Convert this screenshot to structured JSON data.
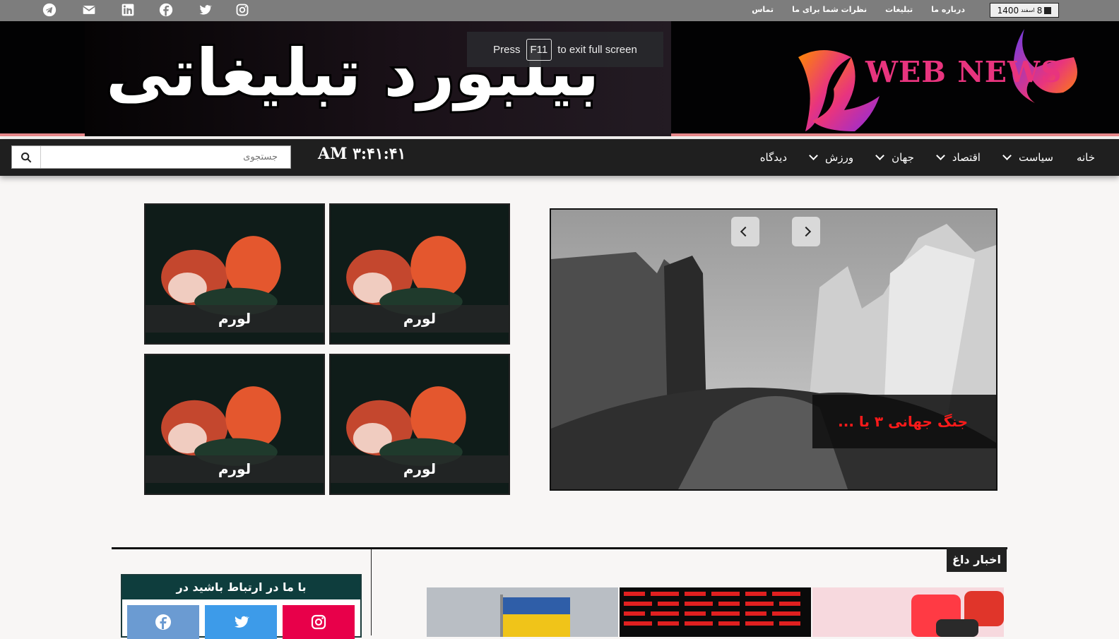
{
  "topbar": {
    "social_icons": [
      "instagram-icon",
      "twitter-icon",
      "facebook-icon",
      "linkedin-icon",
      "mail-icon",
      "telegram-icon"
    ],
    "links": [
      "تماس",
      "نظرات شما برای ما",
      "تبلیغات",
      "درباره ما"
    ],
    "date": {
      "day": "8",
      "month": "اسفند",
      "year": "1400"
    }
  },
  "header": {
    "billboard_text": "بیلبورد تبلیغاتی",
    "fullscreen_msg": {
      "press": "Press",
      "key": "F11",
      "rest": "to exit full screen"
    },
    "logo_text": "WEB NEWS",
    "accent_color": "#e8347e"
  },
  "nav": {
    "search_placeholder": "جستجوی",
    "clock": "AM ۳:۴۱:۴۱",
    "menu": [
      "خانه",
      "سیاست",
      "اقتصاد",
      "جهان",
      "ورزش",
      "دیدگاه"
    ]
  },
  "thumbs": [
    "لورم",
    "لورم",
    "لورم",
    "لورم"
  ],
  "slider": {
    "caption": "جنگ جهانی ۳ یا ..."
  },
  "section": {
    "title": "اخبار داغ",
    "contact_title": "با ما در ارتباط باشید در",
    "contact_buttons": [
      {
        "icon": "instagram-icon",
        "color": "#e8004a"
      },
      {
        "icon": "twitter-icon",
        "color": "#3d9be9"
      },
      {
        "icon": "facebook-icon",
        "color": "#6b9bd2"
      }
    ]
  }
}
